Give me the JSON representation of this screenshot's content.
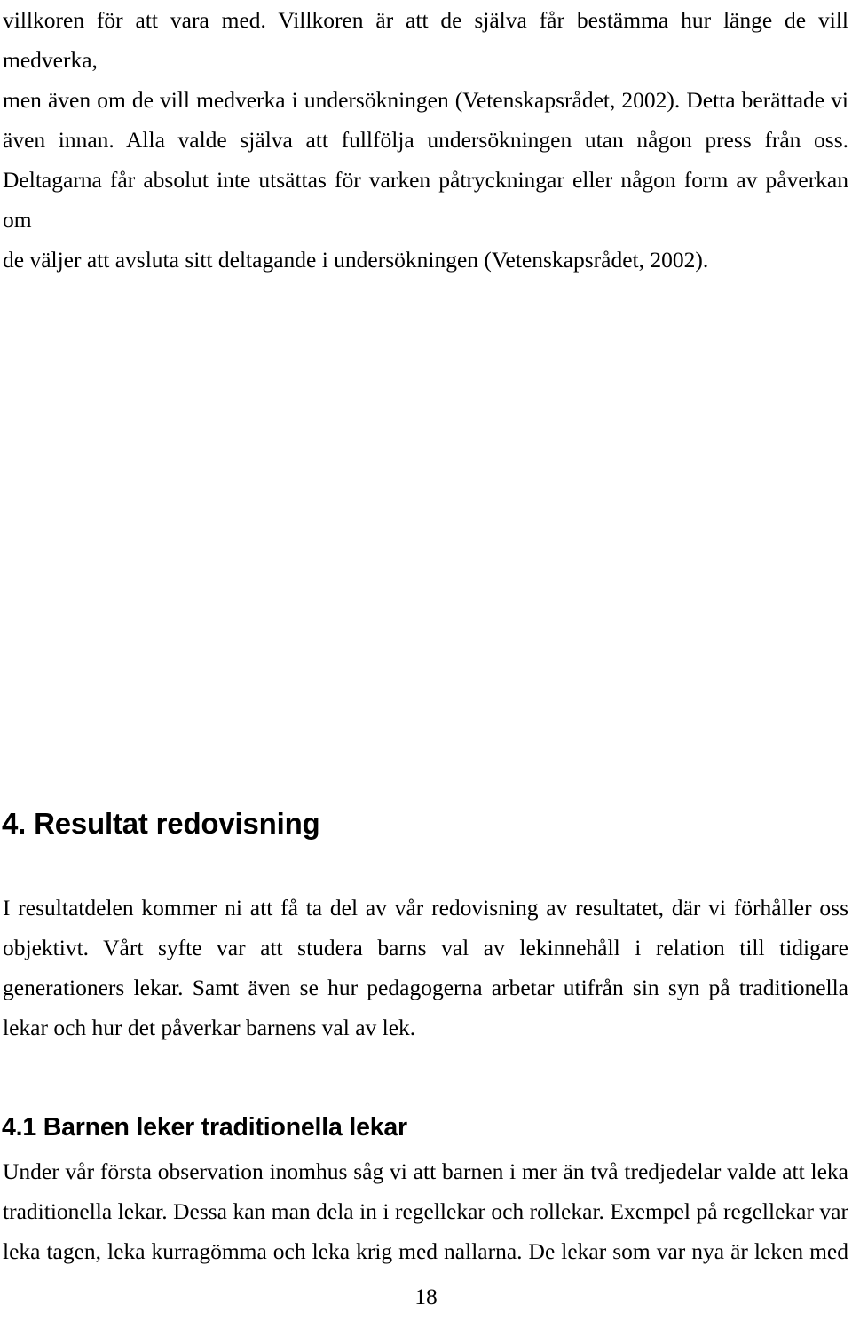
{
  "document": {
    "language": "sv",
    "page_number": "18",
    "background_color": "#ffffff",
    "text_color": "#000000"
  },
  "body": {
    "intro_paragraph": {
      "lines": [
        "villkoren för att vara med. Villkoren är att de själva får bestämma hur länge de vill medverka,",
        "men även om de vill medverka i undersökningen (Vetenskapsrådet, 2002). Detta berättade vi",
        "även innan. Alla valde själva att fullfölja undersökningen utan någon press från oss.",
        "Deltagarna får absolut inte utsättas för varken påtryckningar eller någon form av påverkan om",
        "de väljer att avsluta sitt deltagande i undersökningen (Vetenskapsrådet, 2002)."
      ],
      "text": "villkoren för att vara med. Villkoren är att de själva får bestämma hur länge de vill medverka, men även om de vill medverka i undersökningen (Vetenskapsrådet, 2002). Detta berättade vi även innan. Alla valde själva att fullfölja undersökningen utan någon press från oss. Deltagarna får absolut inte utsättas för varken påtryckningar eller någon form av påverkan om de väljer att avsluta sitt deltagande i undersökningen (Vetenskapsrådet, 2002)."
    },
    "heading_1": {
      "number": "4.",
      "title": "Resultat redovisning",
      "full": "4. Resultat redovisning"
    },
    "result_paragraph": {
      "lines": [
        "I resultatdelen kommer ni att få ta del av vår redovisning av resultatet, där vi förhåller oss",
        "objektivt. Vårt syfte var att studera barns val av lekinnehåll i relation till tidigare",
        "generationers lekar. Samt även se hur pedagogerna arbetar utifrån sin syn på traditionella",
        "lekar och hur det påverkar barnens val av lek."
      ],
      "text": "I resultatdelen kommer ni att få ta del av vår redovisning av resultatet, där vi förhåller oss objektivt. Vårt syfte var att studera barns val av lekinnehåll i relation till tidigare generationers lekar. Samt även se hur pedagogerna arbetar utifrån sin syn på traditionella lekar och hur det påverkar barnens val av lek."
    },
    "heading_2": {
      "number": "4.1",
      "title": "Barnen leker traditionella lekar",
      "full": "4.1 Barnen leker traditionella lekar"
    },
    "subsection_paragraph": {
      "lines": [
        "Under vår första observation inomhus såg vi att barnen i mer än två tredjedelar valde att leka",
        "traditionella lekar. Dessa kan man dela in i regellekar och rollekar. Exempel på regellekar var",
        "leka tagen, leka kurragömma och leka krig med nallarna. De lekar som var nya är leken med"
      ],
      "text": "Under vår första observation inomhus såg vi att barnen i mer än två tredjedelar valde att leka traditionella lekar. Dessa kan man dela in i regellekar och rollekar. Exempel på regellekar var leka tagen, leka kurragömma och leka krig med nallarna. De lekar som var nya är leken med"
    }
  },
  "footer": {
    "page_number": "18"
  }
}
